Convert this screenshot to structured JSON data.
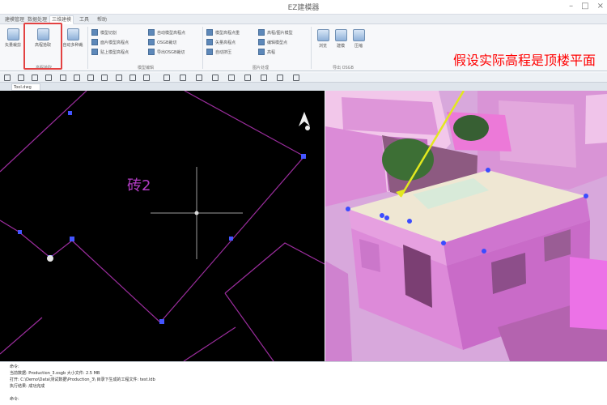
{
  "window": {
    "title": "EZ建模器",
    "controls": [
      "–",
      "□",
      "×"
    ]
  },
  "tabs": [
    {
      "label": "建模管理"
    },
    {
      "label": "数据处理"
    },
    {
      "label": "三维建模"
    },
    {
      "label": "工具"
    },
    {
      "label": "帮助"
    }
  ],
  "ribbon": {
    "buttons": [
      {
        "label": "矢量裁剪"
      },
      {
        "label": "高程拾取"
      },
      {
        "label": "自动多种裁"
      }
    ],
    "groups": [
      {
        "label": "高程拾取"
      },
      {
        "label": "模型编辑"
      },
      {
        "label": "图片处理"
      },
      {
        "label": "导出 OSGB"
      }
    ],
    "small_items": [
      {
        "label": "模型切割"
      },
      {
        "label": "面片模型高程点"
      },
      {
        "label": "贴上模型高程点"
      },
      {
        "label": "自动模型高程点"
      },
      {
        "label": "OSGB裁切"
      },
      {
        "label": "导出OSGB裁切"
      },
      {
        "label": "模型高程点重"
      },
      {
        "label": "矢量高程点"
      },
      {
        "label": "自动挤压"
      },
      {
        "label": "高程/图片模型"
      },
      {
        "label": "编辑模型点"
      },
      {
        "label": "高程"
      },
      {
        "label": "浏览"
      },
      {
        "label": "建模"
      },
      {
        "label": "压缩"
      }
    ]
  },
  "annotation": {
    "text": "假设实际高程是顶楼平面",
    "color": "#ff0000"
  },
  "views": {
    "left_label": "砖2"
  },
  "document_tab": {
    "label": "Tool.dwg"
  },
  "status": {
    "lines": [
      "命令:",
      "当前数据: Production_3.osgb 大小文件: 2.5 MB",
      "打开: C:\\Demo\\Data\\测试数据\\Production_3\\ 目录下生成的工程文件: test.ldb",
      "执行结果: 成功完成",
      "命令:"
    ]
  }
}
